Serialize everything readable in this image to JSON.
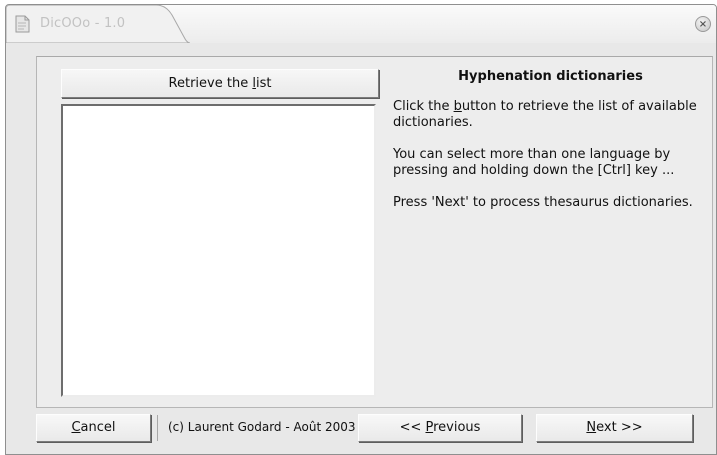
{
  "window": {
    "title": "DicOOo - 1.0",
    "close_glyph": "×"
  },
  "left_panel": {
    "retrieve_button": {
      "before": "Retrieve the ",
      "mnemonic": "l",
      "after": "ist"
    }
  },
  "info": {
    "title": "Hyphenation dictionaries",
    "p1": {
      "before": "Click the ",
      "mnemonic": "b",
      "after": "utton to retrieve the list of available dictionaries."
    },
    "p2": "You can select more than one language by pressing and holding down  the [Ctrl] key ...",
    "p3": "Press 'Next' to process thesaurus dictionaries."
  },
  "footer": {
    "cancel": {
      "mnemonic": "C",
      "after": "ancel"
    },
    "copyright": "(c) Laurent Godard - Août 2003",
    "previous": {
      "before": "<< ",
      "mnemonic": "P",
      "after": "revious"
    },
    "next": {
      "mnemonic": "N",
      "after": "ext >>"
    }
  },
  "icons": [
    "app-document-icon",
    "close-icon"
  ],
  "colors": {
    "window_bg": "#e8e8e8",
    "list_bg": "#ffffff",
    "title_text": "#c2c2c2"
  }
}
